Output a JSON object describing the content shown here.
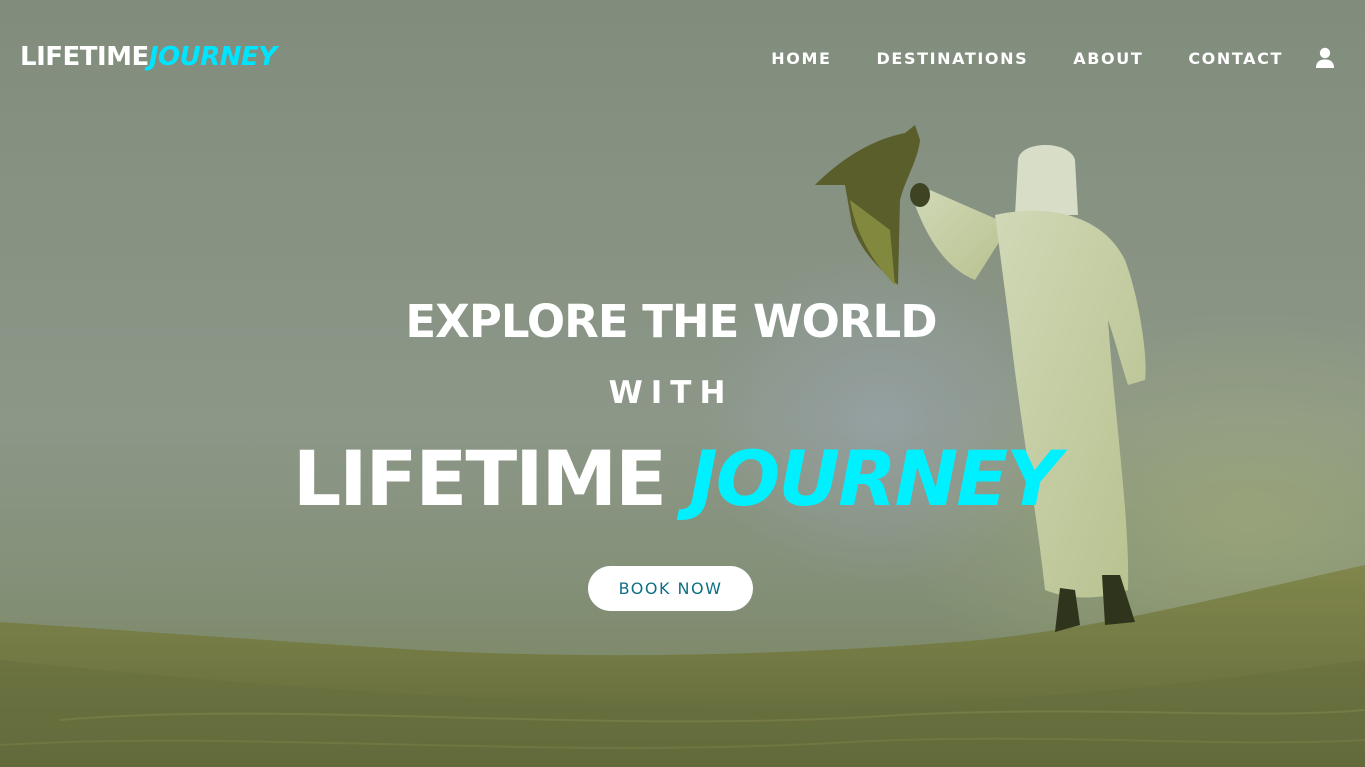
{
  "brand": {
    "logo_part1": "LIFETIME",
    "logo_part2": "JOURNEY",
    "accent_color": "#00e5ff"
  },
  "nav": {
    "items": [
      {
        "label": "HOME"
      },
      {
        "label": "DESTINATIONS"
      },
      {
        "label": "ABOUT"
      },
      {
        "label": "CONTACT"
      }
    ],
    "user_icon": "user-icon"
  },
  "hero": {
    "line1": "EXPLORE THE WORLD",
    "line2": "WITH",
    "line3_part1": "LIFETIME",
    "line3_part2": "JOURNEY",
    "cta_label": "BOOK NOW",
    "cta_text_color": "#0f6f85"
  }
}
